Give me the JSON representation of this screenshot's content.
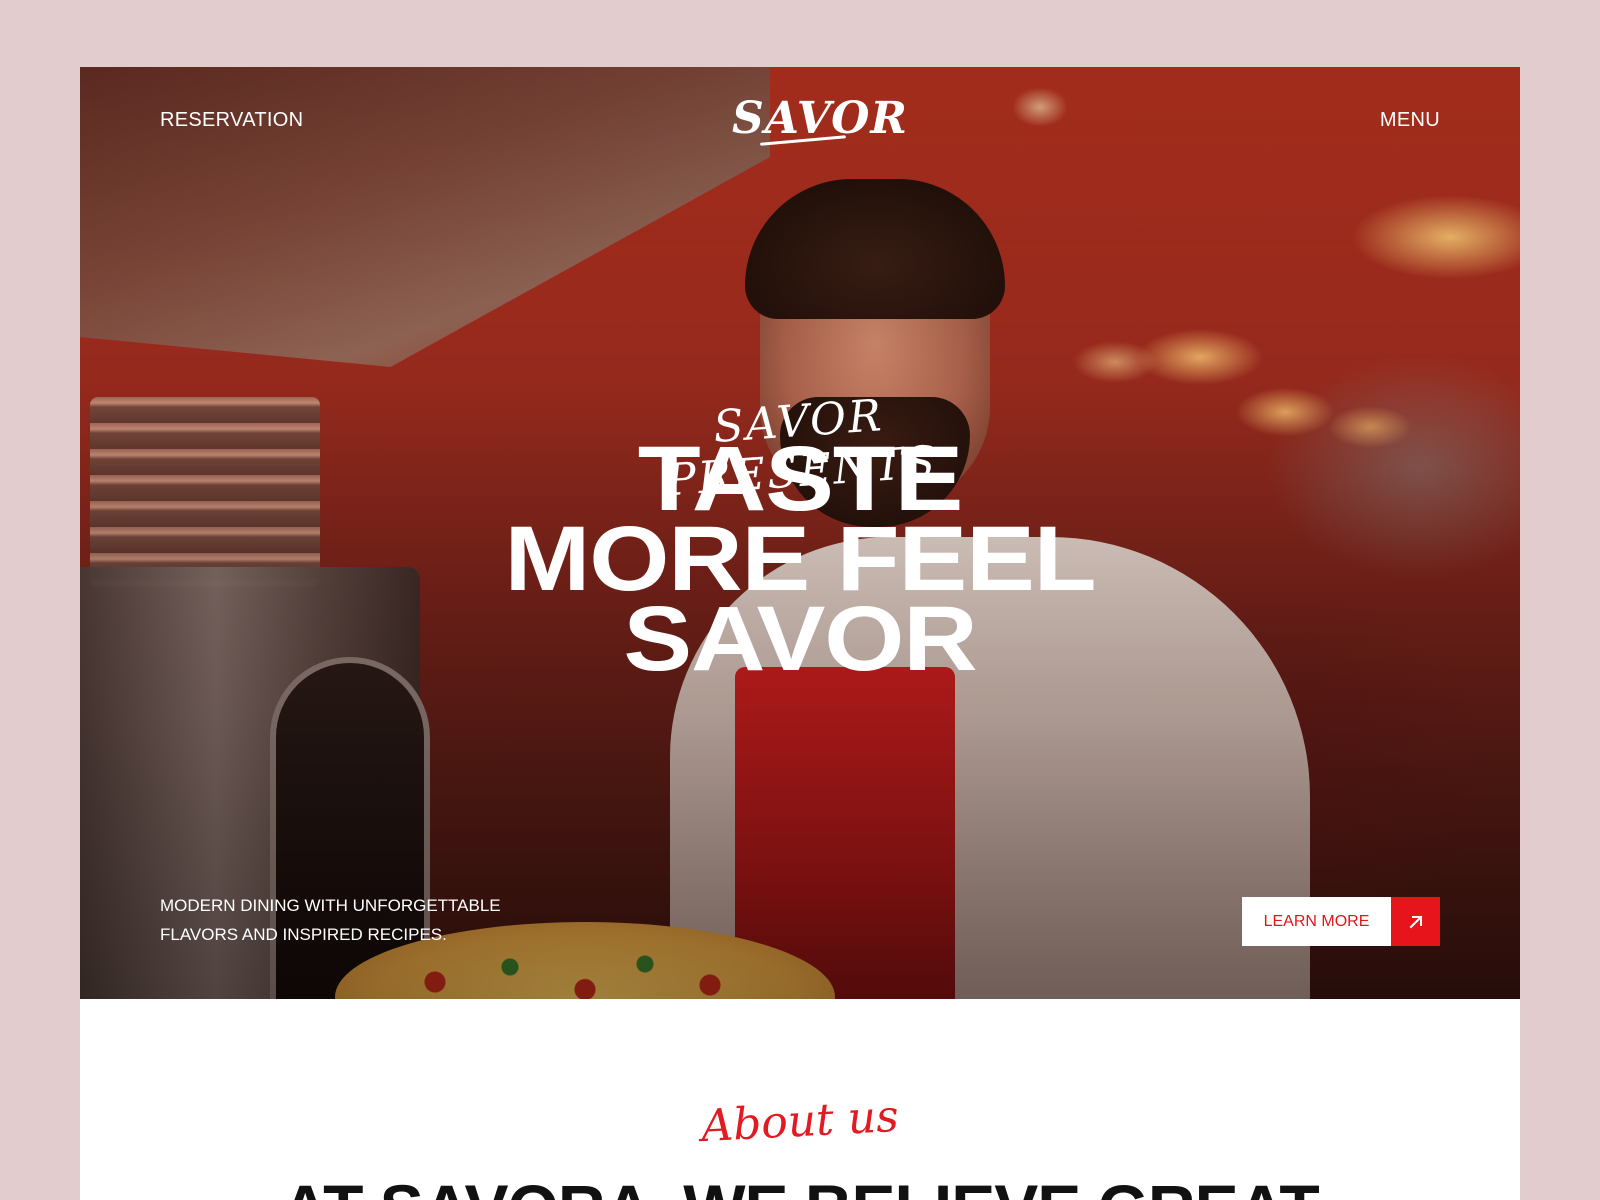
{
  "nav": {
    "reservation_label": "RESERVATION",
    "menu_label": "MENU",
    "logo_text": "SAVOR"
  },
  "hero": {
    "kicker": "SAVOR PRESENTS",
    "headline": [
      "TASTE",
      "MORE FEEL",
      "SAVOR"
    ],
    "tagline_lines": [
      "MODERN DINING WITH UNFORGETTABLE",
      "FLAVORS AND INSPIRED RECIPES."
    ],
    "cta_label": "LEARN MORE",
    "cta_icon": "arrow-up-right-icon",
    "image_description_icon": "chef-with-pizza-photo"
  },
  "about": {
    "kicker": "About us",
    "heading_left": "AT SAVORA",
    "heading_right": "WE BELIEVE GREAT"
  },
  "colors": {
    "page_background": "#e2cccd",
    "accent_red": "#e8141c",
    "text_white": "#ffffff",
    "text_dark": "#111111"
  }
}
